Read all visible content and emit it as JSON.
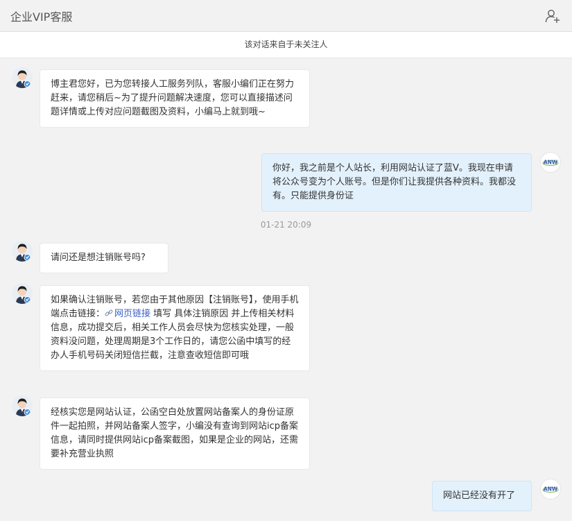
{
  "header": {
    "title": "企业VIP客服",
    "add_contact_icon": "person-add-icon"
  },
  "notice": "该对话来自于未关注人",
  "timestamp": "01-21 20:09",
  "messages": [
    {
      "from": "agent",
      "text": "博主君您好，已为您转接人工服务列队，客服小编们正在努力赶来，请您稍后~为了提升问题解决速度，您可以直接描述问题详情或上传对应问题截图及资料，小编马上就到哦~"
    },
    {
      "from": "user",
      "text": "你好，我之前是个人站长，利用网站认证了蓝V。我现在申请将公众号变为个人账号。但是你们让我提供各种资料。我都没有。只能提供身份证"
    },
    {
      "from": "agent",
      "text": "请问还是想注销账号吗?"
    },
    {
      "from": "agent",
      "text_before": "如果确认注销账号，若您由于其他原因【注销账号】，使用手机端点击链接：",
      "link": "网页链接",
      "text_after": " 填写 具体注销原因 并上传相关材料信息，成功提交后，相关工作人员会尽快为您核实处理，一般资料没问题，处理周期是3个工作日的，请您公函中填写的经办人手机号码关闭短信拦截，注意查收短信即可哦"
    },
    {
      "from": "agent",
      "text": "经核实您是网站认证，公函空白处放置网站备案人的身份证原件一起拍照，并网站备案人签字，小编没有查询到网站icp备案信息，请同时提供网站icp备案截图，如果是企业的网站，还需要补充营业执照"
    },
    {
      "from": "user",
      "text": "网站已经没有开了"
    }
  ],
  "user_avatar_logo": "ANW",
  "colors": {
    "background": "#f2f2f2",
    "user_bubble": "#e3f1fc",
    "agent_bubble": "#ffffff",
    "verified_badge": "#3a8ee6"
  }
}
